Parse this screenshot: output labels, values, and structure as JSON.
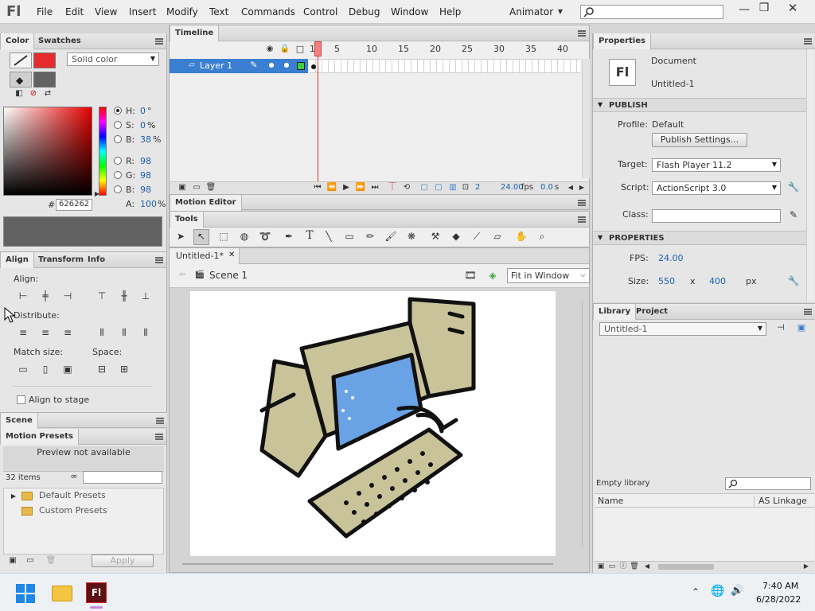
{
  "app": {
    "logo": "Fl"
  },
  "menu": {
    "items": [
      "File",
      "Edit",
      "View",
      "Insert",
      "Modify",
      "Text",
      "Commands",
      "Control",
      "Debug",
      "Window",
      "Help"
    ],
    "workspace": "Animator"
  },
  "color_panel": {
    "tabs": [
      "Color",
      "Swatches"
    ],
    "type": "Solid color",
    "hsb": {
      "h_label": "H:",
      "h": "0",
      "h_unit": "°",
      "s_label": "S:",
      "s": "0",
      "s_unit": "%",
      "b_label": "B:",
      "b": "38",
      "b_unit": "%"
    },
    "rgb": {
      "r_label": "R:",
      "r": "98",
      "g_label": "G:",
      "g": "98",
      "b_label": "B:",
      "b": "98",
      "a_label": "A:",
      "a": "100",
      "a_unit": "%"
    },
    "hex_label": "#",
    "hex": "626262",
    "swatch_color": "#626262",
    "stroke_color": "#e52b2b"
  },
  "align_panel": {
    "tabs": [
      "Align",
      "Transform",
      "Info"
    ],
    "align": "Align:",
    "distribute": "Distribute:",
    "match_size": "Match size:",
    "space": "Space:",
    "align_to_stage": "Align to stage"
  },
  "scene_panel": {
    "title": "Scene"
  },
  "motion_presets": {
    "title": "Motion Presets",
    "preview": "Preview not available",
    "count": "32 items",
    "folders": [
      "Default Presets",
      "Custom Presets"
    ],
    "apply": "Apply"
  },
  "timeline": {
    "title": "Timeline",
    "layer": "Layer 1",
    "frame_numbers": [
      "1",
      "5",
      "10",
      "15",
      "20",
      "25",
      "30",
      "35",
      "40"
    ],
    "frame": "2",
    "fps": "24.00",
    "fps_unit": "fps",
    "time": "0.0",
    "time_unit": "s"
  },
  "motion_editor": {
    "title": "Motion Editor"
  },
  "tools": {
    "title": "Tools"
  },
  "document": {
    "tab": "Untitled-1*",
    "scene": "Scene 1",
    "zoom": "Fit in Window"
  },
  "properties": {
    "title": "Properties",
    "doc_type": "Document",
    "doc_name": "Untitled-1",
    "publish_header": "PUBLISH",
    "profile_label": "Profile:",
    "profile": "Default",
    "publish_settings": "Publish Settings...",
    "target_label": "Target:",
    "target": "Flash Player 11.2",
    "script_label": "Script:",
    "script": "ActionScript 3.0",
    "class_label": "Class:",
    "properties_header": "PROPERTIES",
    "fps_label": "FPS:",
    "fps": "24.00",
    "size_label": "Size:",
    "width": "550",
    "x": "x",
    "height": "400",
    "unit": "px"
  },
  "library": {
    "tabs": [
      "Library",
      "Project"
    ],
    "doc": "Untitled-1",
    "empty": "Empty library",
    "col_name": "Name",
    "col_linkage": "AS Linkage"
  },
  "taskbar": {
    "time": "7:40 AM",
    "date": "6/28/2022"
  }
}
